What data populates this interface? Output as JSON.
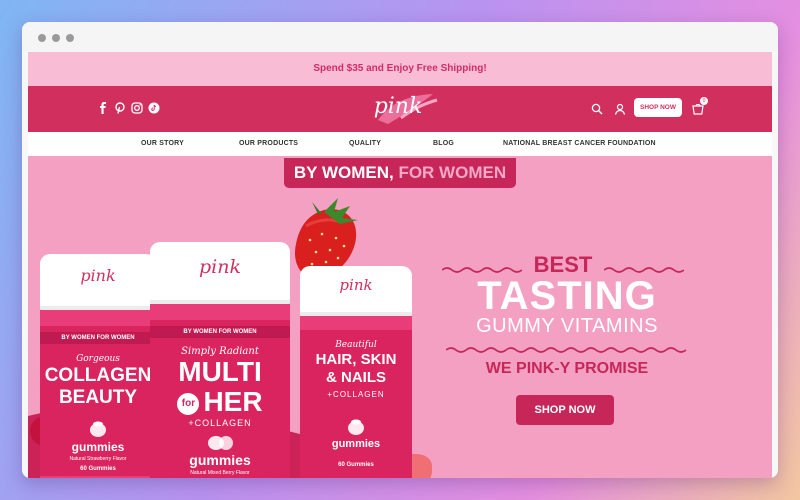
{
  "window": {
    "controls": [
      "dot",
      "dot",
      "dot"
    ]
  },
  "promo": {
    "text": "Spend $35 and Enjoy Free Shipping!"
  },
  "header": {
    "social_icons": [
      "facebook-icon",
      "pinterest-icon",
      "instagram-icon",
      "tiktok-icon"
    ],
    "logo": "pink",
    "shop_now_label": "SHOP NOW",
    "cart_count": "0",
    "colors": {
      "header_bg": "#d1305f",
      "promo_bg": "#f8bdd5",
      "hero_bg": "#f4a0c2",
      "accent": "#c72758"
    }
  },
  "nav": {
    "items": [
      {
        "label": "OUR STORY"
      },
      {
        "label": "OUR PRODUCTS"
      },
      {
        "label": "QUALITY"
      },
      {
        "label": "BLOG"
      },
      {
        "label": "NATIONAL BREAST CANCER FOUNDATION"
      }
    ]
  },
  "hero": {
    "tagline_main": "BY WOMEN, ",
    "tagline_alt": "FOR WOMEN",
    "headline_best": "BEST",
    "headline_tasting": "TASTING",
    "headline_gummy": "GUMMY VITAMINS",
    "headline_promise": "WE PINK-Y PROMISE",
    "shop_now_label": "SHOP NOW",
    "bottles": [
      {
        "logo": "pink",
        "flag": "BY WOMEN FOR WOMEN",
        "script": "Gorgeous",
        "name_line1": "COLLAGEN",
        "name_line2": "BEAUTY",
        "gummies": "gummies",
        "flavor": "Natural Strawberry Flavor",
        "count": "60 Gummies"
      },
      {
        "logo": "pink",
        "flag": "BY WOMEN FOR WOMEN",
        "script": "Simply Radiant",
        "name_line1": "MULTI",
        "name_for": "for",
        "name_line2": "HER",
        "sub": "+COLLAGEN",
        "gummies": "gummies",
        "flavor": "Natural Mixed Berry Flavor"
      },
      {
        "logo": "pink",
        "script": "Beautiful",
        "name_line1": "HAIR, SKIN",
        "name_line2": "& NAILS",
        "sub": "+COLLAGEN",
        "gummies": "gummies",
        "count": "60 Gummies"
      }
    ]
  }
}
